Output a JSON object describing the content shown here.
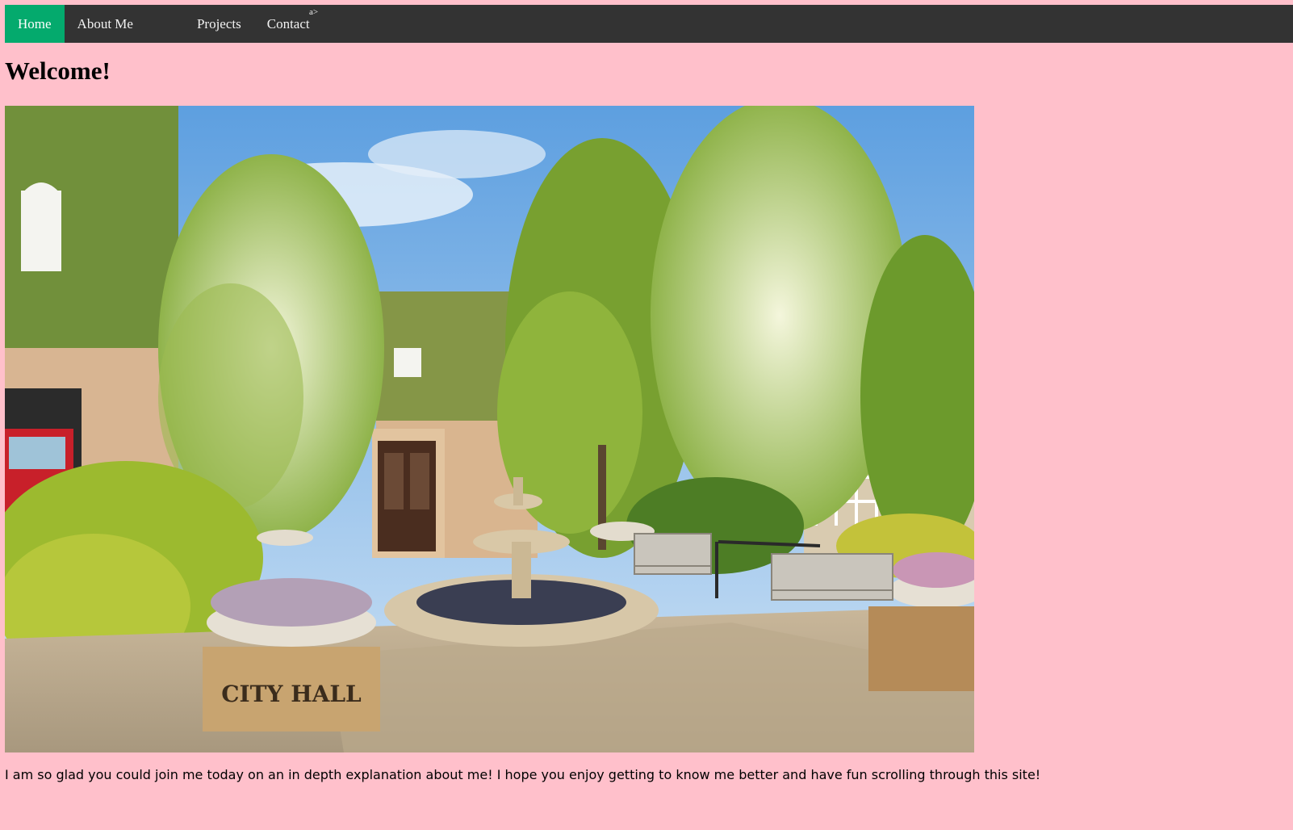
{
  "nav": {
    "items": [
      {
        "label": "Home",
        "active": true
      },
      {
        "label": "About Me",
        "active": false
      },
      {
        "label": "Projects",
        "active": false
      },
      {
        "label": "Contact",
        "active": false
      }
    ],
    "stray_text": "a>"
  },
  "page": {
    "title": "Welcome!",
    "intro": "I am so glad you could join me today on an in depth explanation about me! I hope you enjoy getting to know me better and have fun scrolling through this site!"
  },
  "hero_image": {
    "sign_text": "CITY HALL"
  },
  "colors": {
    "background": "#ffc0cb",
    "nav_background": "#333333",
    "nav_active": "#04aa6d",
    "nav_text": "#f2f2f2"
  }
}
